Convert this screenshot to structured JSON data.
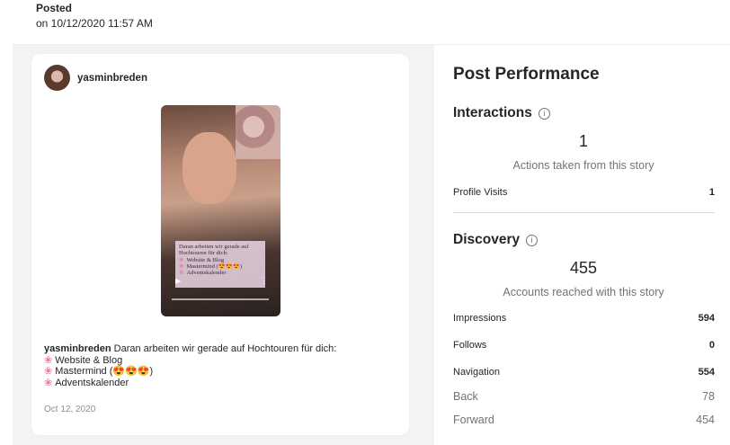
{
  "header": {
    "posted_label": "Posted",
    "posted_date": "on 10/12/2020 11:57 AM"
  },
  "post": {
    "username": "yasminbreden",
    "story_caption": {
      "line1": "Daran arbeiten wir gerade auf",
      "line2": "Hochtouren für dich:",
      "item1": "Website & Blog",
      "item2": "Mastermind (😍😍😍)",
      "item3": "Adventskalender"
    },
    "caption": {
      "username": "yasminbreden",
      "text": "Daran arbeiten wir gerade auf Hochtouren für dich:",
      "items": [
        "Website & Blog",
        "Mastermind (😍😍😍)",
        "Adventskalender"
      ]
    },
    "date": "Oct 12, 2020"
  },
  "performance": {
    "title": "Post Performance",
    "interactions": {
      "title": "Interactions",
      "value": "1",
      "caption": "Actions taken from this story",
      "rows": [
        {
          "label": "Profile Visits",
          "value": "1"
        }
      ]
    },
    "discovery": {
      "title": "Discovery",
      "value": "455",
      "caption": "Accounts reached with this story",
      "rows": [
        {
          "label": "Impressions",
          "value": "594"
        },
        {
          "label": "Follows",
          "value": "0"
        },
        {
          "label": "Navigation",
          "value": "554"
        }
      ],
      "sub_rows": [
        {
          "label": "Back",
          "value": "78"
        },
        {
          "label": "Forward",
          "value": "454"
        }
      ]
    }
  },
  "icons": {
    "info": "info-icon",
    "flower_bullet": "flower-icon",
    "play": "play-icon",
    "more": "more-icon"
  }
}
